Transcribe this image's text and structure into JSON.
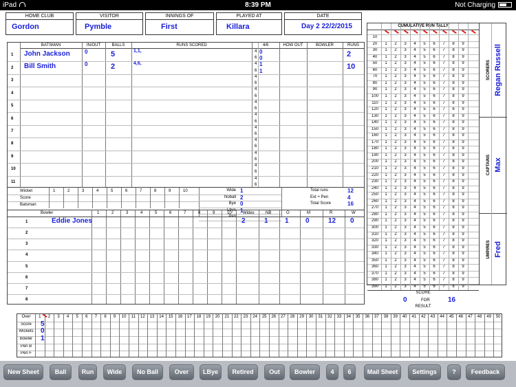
{
  "status": {
    "device": "iPad",
    "time": "8:39 PM",
    "battery": "Not Charging"
  },
  "header": {
    "home_club": {
      "label": "HOME CLUB",
      "value": "Gordon"
    },
    "visitor": {
      "label": "VISITOR",
      "value": "Pymble"
    },
    "innings": {
      "label": "INNINGS OF",
      "value": "First"
    },
    "played_at": {
      "label": "PLAYED AT",
      "value": "Killara"
    },
    "date": {
      "label": "DATE",
      "value": "Day 2 22/2/2015"
    }
  },
  "batting": {
    "headers": {
      "batsman": "BATSMAN",
      "inout": "IN/OUT",
      "balls": "BALLS",
      "runs_scored": "RUNS SCORED",
      "fours_sixes": "4/6",
      "how_out": "HOW OUT",
      "bowler": "BOWLER",
      "runs": "RUNS"
    },
    "rows": [
      {
        "n": "1",
        "name": "John Jackson",
        "inout": "0",
        "balls": "5",
        "scored": "1,1,",
        "runs": "2"
      },
      {
        "n": "2",
        "name": "Bill Smith",
        "inout": "0",
        "balls": "2",
        "scored": "4,6,",
        "runs": "10"
      },
      {
        "n": "3",
        "name": "",
        "inout": "",
        "balls": "",
        "scored": "",
        "runs": ""
      },
      {
        "n": "4",
        "name": "",
        "inout": "",
        "balls": "",
        "scored": "",
        "runs": ""
      },
      {
        "n": "5",
        "name": "",
        "inout": "",
        "balls": "",
        "scored": "",
        "runs": ""
      },
      {
        "n": "6",
        "name": "",
        "inout": "",
        "balls": "",
        "scored": "",
        "runs": ""
      },
      {
        "n": "7",
        "name": "",
        "inout": "",
        "balls": "",
        "scored": "",
        "runs": ""
      },
      {
        "n": "8",
        "name": "",
        "inout": "",
        "balls": "",
        "scored": "",
        "runs": ""
      },
      {
        "n": "9",
        "name": "",
        "inout": "",
        "balls": "",
        "scored": "",
        "runs": ""
      },
      {
        "n": "10",
        "name": "",
        "inout": "",
        "balls": "",
        "scored": "",
        "runs": ""
      },
      {
        "n": "11",
        "name": "",
        "inout": "",
        "balls": "",
        "scored": "",
        "runs": ""
      }
    ],
    "fours_col": [
      "4",
      "6",
      "4",
      "6"
    ],
    "fours_vals": [
      "0",
      "0",
      "1",
      "1"
    ]
  },
  "fow": {
    "wicket": "Wicket",
    "score": "Score",
    "batsman": "Batsman",
    "nums": [
      "1",
      "2",
      "3",
      "4",
      "5",
      "6",
      "7",
      "8",
      "9",
      "10"
    ]
  },
  "extras": [
    {
      "label": "Wide",
      "value": "1"
    },
    {
      "label": "Noball",
      "value": "2"
    },
    {
      "label": "Bye",
      "value": "0"
    },
    {
      "label": "Lbye",
      "value": "1"
    },
    {
      "label": "Pen",
      "value": ""
    }
  ],
  "totals": [
    {
      "label": "Total runs",
      "value": "12"
    },
    {
      "label": "Ext + Pen",
      "value": "4"
    },
    {
      "label": "Total Score",
      "value": "16"
    }
  ],
  "bowling": {
    "headers": {
      "bowler": "Bowler",
      "wides": "Wides",
      "nb": "NB",
      "o": "O",
      "m": "M",
      "r": "R",
      "w": "W"
    },
    "overs": [
      "1",
      "2",
      "3",
      "4",
      "5",
      "6",
      "7",
      "8",
      "9",
      "10"
    ],
    "rows": [
      {
        "n": "1",
        "name": "Eddie Jones",
        "wides": "2",
        "nb": "1",
        "o": "1",
        "m": "0",
        "r": "12",
        "w": "0"
      },
      {
        "n": "2"
      },
      {
        "n": "3"
      },
      {
        "n": "4"
      },
      {
        "n": "5"
      },
      {
        "n": "6"
      },
      {
        "n": "7"
      },
      {
        "n": "8"
      }
    ]
  },
  "tally": {
    "title": "CUMULATIVE RUN TALLY",
    "cols": [
      "1",
      "2",
      "3",
      "4",
      "5",
      "6",
      "7",
      "8",
      "9"
    ],
    "rows": [
      "10",
      "20",
      "30",
      "40",
      "50",
      "60",
      "70",
      "80",
      "90",
      "100",
      "110",
      "120",
      "130",
      "140",
      "150",
      "160",
      "170",
      "180",
      "190",
      "200",
      "210",
      "220",
      "230",
      "240",
      "250",
      "260",
      "270",
      "280",
      "290",
      "300",
      "310",
      "320",
      "330",
      "340",
      "350",
      "360",
      "370",
      "380",
      "390"
    ],
    "score_label": "SCORE",
    "score": "0",
    "for_label": "FOR",
    "for": "16",
    "result_label": "RESULT"
  },
  "side": {
    "scorers_label": "SCORERS",
    "scorer": "Regan Russell",
    "captains_label": "CAPTAINS",
    "captain": "Max",
    "umpires_label": "UMPIRES",
    "umpire": "Fred"
  },
  "overs_grid": {
    "labels": [
      "Over",
      "Score",
      "Wickets",
      "Bowler",
      "Pen B",
      "Pen F"
    ],
    "vals": [
      "5",
      "0",
      "1"
    ]
  },
  "buttons": [
    "New Sheet",
    "Ball",
    "Run",
    "Wide",
    "No Ball",
    "Over",
    "LBye",
    "Retired",
    "Out",
    "Bowler",
    "4",
    "6",
    "Mail Sheet",
    "Settings",
    "?",
    "Feedback"
  ]
}
